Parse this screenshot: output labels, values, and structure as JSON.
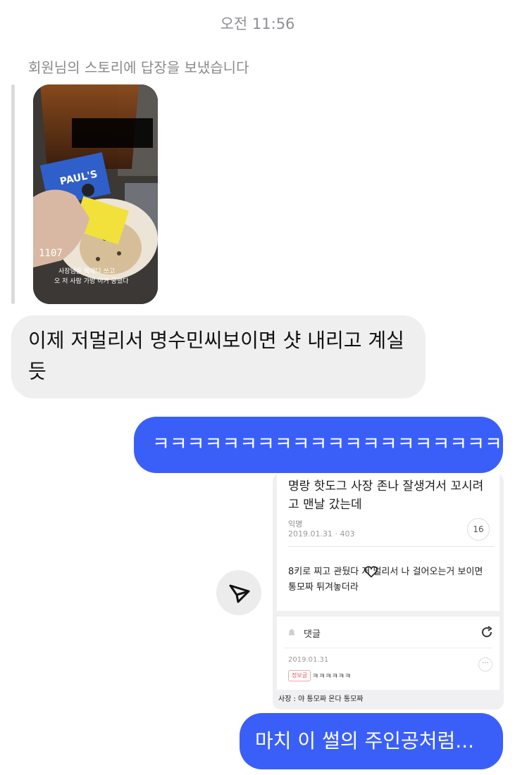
{
  "header": {
    "timestamp": "오전 11:56"
  },
  "story_reply": {
    "label": "회원님의 스토리에 답장을 보냈습니다",
    "story_text": {
      "counter": "1107",
      "bottom_line1": "사장님은 목에다 쓰고",
      "bottom_line2": "오 저 사람 가방 이거 궁했다",
      "sticker_brand": "PAUL'S"
    }
  },
  "messages": {
    "received_1": "이제 저멀리서 명수민씨보이면 샷 내리고 계실듯",
    "sent_1": "ㅋㅋㅋㅋㅋㅋㅋㅋㅋㅋㅋㅋㅋㅋㅋㅋㅋㅋㅋㅋ 아",
    "sent_2": "마치 이 썰의 주인공처럼..."
  },
  "shared_post": {
    "title": "명랑 핫도그 사장 존나 잘생겨서 꼬시려고 맨날 갔는데",
    "author": "익명",
    "meta": "2019.01.31 · 403",
    "comment_count": "16",
    "body": "8키로 찌고 관뒀다 저 멀리서 나 걸어오는거 보이면 통모짜 튀겨놓더라",
    "comments_label": "댓글",
    "comment_date": "2019.01.31",
    "comment_tag": "정보글",
    "comment_text": "ㅋㅋㅋㅋㅋㅋ",
    "caption": "사장 : 야 통모짜 온다 통모짜",
    "more": "···"
  },
  "icons": {
    "share": "paper-plane-icon",
    "heart": "heart-icon",
    "bell": "bell-icon",
    "refresh": "refresh-icon"
  },
  "colors": {
    "sent_bubble": "#3a5ff9",
    "received_bubble": "#efefef",
    "timestamp": "#8e8e93"
  }
}
